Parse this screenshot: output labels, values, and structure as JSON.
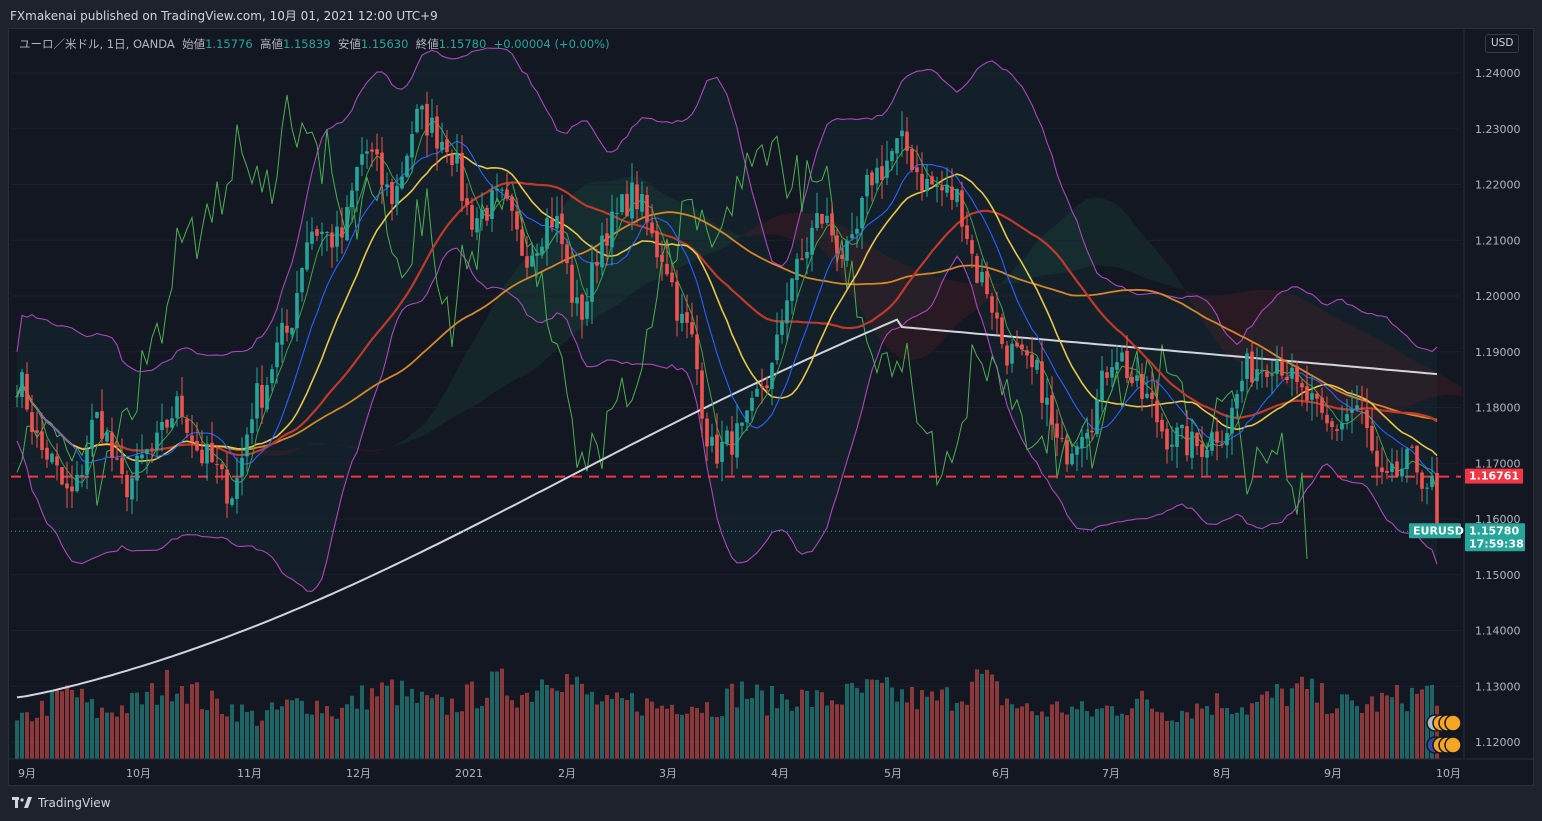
{
  "header": {
    "published_line": "FXmakenai published on TradingView.com, 10月 01, 2021 12:00 UTC+9"
  },
  "legend": {
    "symbol": "ユーロ／米ドル, 1日, OANDA",
    "open_label": "始値",
    "open": "1.15776",
    "high_label": "高値",
    "high": "1.15839",
    "low_label": "安値",
    "low": "1.15630",
    "close_label": "終値",
    "close": "1.15780",
    "change": "+0.00004 (+0.00%)"
  },
  "currency_button": "USD",
  "footer": {
    "brand": "TradingView"
  },
  "colors": {
    "up": "#26a69a",
    "down": "#ef5350",
    "bollinger": "#ab47bc",
    "ma_fast": "#2962ff",
    "ma_yellow": "#e6c74c",
    "ma_red": "#c0392b",
    "ma_orange": "#d4862c",
    "ma_200": "#d1d4dc",
    "lagging": "#4caf50",
    "support": "#f23645"
  },
  "chart_data": {
    "type": "candlestick",
    "symbol_tag": "EURUSD",
    "current_price": "1.15780",
    "countdown": "17:59:38",
    "support_level_label": "1.16761",
    "support_level": 1.16761,
    "y_axis_ticks": [
      "1.24000",
      "1.23000",
      "1.22000",
      "1.21000",
      "1.20000",
      "1.19000",
      "1.18000",
      "1.17000",
      "1.16000",
      "1.15000",
      "1.14000",
      "1.13000",
      "1.12000"
    ],
    "ylim": [
      1.117,
      1.2455
    ],
    "x_axis_ticks": [
      "9月",
      "10月",
      "11月",
      "12月",
      "2021",
      "2月",
      "3月",
      "4月",
      "5月",
      "6月",
      "7月",
      "8月",
      "9月",
      "10月"
    ],
    "close_path": [
      1.185,
      1.172,
      1.164,
      1.178,
      1.166,
      1.172,
      1.18,
      1.171,
      1.165,
      1.182,
      1.193,
      1.212,
      1.21,
      1.226,
      1.218,
      1.232,
      1.228,
      1.214,
      1.217,
      1.208,
      1.214,
      1.197,
      1.212,
      1.218,
      1.208,
      1.194,
      1.172,
      1.175,
      1.185,
      1.204,
      1.214,
      1.207,
      1.222,
      1.227,
      1.22,
      1.218,
      1.203,
      1.19,
      1.186,
      1.172,
      1.178,
      1.19,
      1.182,
      1.175,
      1.173,
      1.176,
      1.187,
      1.189,
      1.182,
      1.176,
      1.18,
      1.166,
      1.17,
      1.165
    ],
    "volume_path": [
      0.3,
      0.45,
      0.6,
      0.4,
      0.45,
      0.55,
      0.7,
      0.5,
      0.45,
      0.35,
      0.45,
      0.5,
      0.4,
      0.55,
      0.6,
      0.5,
      0.45,
      0.55,
      0.65,
      0.55,
      0.8,
      0.6,
      0.45,
      0.5,
      0.45,
      0.5,
      0.45,
      0.6,
      0.5,
      0.55,
      0.5,
      0.55,
      0.6,
      0.55,
      0.5,
      0.55,
      0.7,
      0.5,
      0.4,
      0.45,
      0.4,
      0.45,
      0.5,
      0.4,
      0.45,
      0.5,
      0.45,
      0.55,
      0.6,
      0.5,
      0.45,
      0.5,
      0.55,
      0.6
    ]
  }
}
